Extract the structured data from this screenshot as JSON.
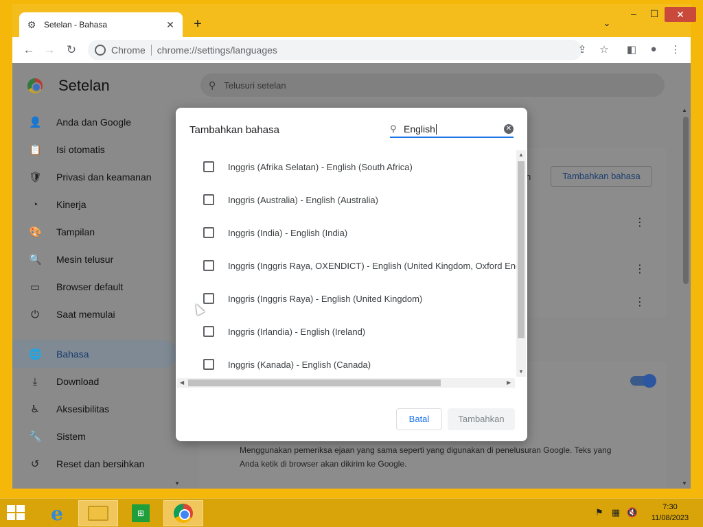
{
  "browser": {
    "tab_title": "Setelan - Bahasa",
    "new_tab": "+",
    "window_controls": {
      "minimize": "‒",
      "maximize": "☐",
      "close": "✕"
    },
    "omnibox": {
      "chip": "Chrome",
      "url": "chrome://settings/languages"
    }
  },
  "settings": {
    "title": "Setelan",
    "search_placeholder": "Telusuri setelan",
    "sidebar": [
      {
        "label": "Anda dan Google",
        "icon": "person-icon",
        "glyph": "👤"
      },
      {
        "label": "Isi otomatis",
        "icon": "clipboard-icon",
        "glyph": "📋"
      },
      {
        "label": "Privasi dan keamanan",
        "icon": "shield-icon",
        "glyph": "🛡"
      },
      {
        "label": "Kinerja",
        "icon": "gauge-icon",
        "glyph": "◔"
      },
      {
        "label": "Tampilan",
        "icon": "palette-icon",
        "glyph": "🎨"
      },
      {
        "label": "Mesin telusur",
        "icon": "search-icon",
        "glyph": "🔍"
      },
      {
        "label": "Browser default",
        "icon": "browser-icon",
        "glyph": "▭"
      },
      {
        "label": "Saat memulai",
        "icon": "power-icon",
        "glyph": "⏻"
      },
      {
        "label": "Bahasa",
        "icon": "globe-icon",
        "glyph": "🌐",
        "active": true
      },
      {
        "label": "Download",
        "icon": "download-icon",
        "glyph": "⤓"
      },
      {
        "label": "Aksesibilitas",
        "icon": "accessibility-icon",
        "glyph": "♿"
      },
      {
        "label": "Sistem",
        "icon": "wrench-icon",
        "glyph": "🔧"
      },
      {
        "label": "Reset dan bersihkan",
        "icon": "reset-icon",
        "glyph": "↺"
      }
    ],
    "card_button": "Tambahkan bahasa",
    "card_fragment": "n",
    "card2_description": "Menggunakan pemeriksa ejaan yang sama seperti yang digunakan di penelusuran Google. Teks yang Anda ketik di browser akan dikirim ke Google."
  },
  "dialog": {
    "title": "Tambahkan bahasa",
    "search_value": "English",
    "languages": [
      "Inggris (Afrika Selatan) - English (South Africa)",
      "Inggris (Australia) - English (Australia)",
      "Inggris (India) - English (India)",
      "Inggris (Inggris Raya, OXENDICT) - English (United Kingdom, Oxford English Dictionary spelling)",
      "Inggris (Inggris Raya) - English (United Kingdom)",
      "Inggris (Irlandia) - English (Ireland)",
      "Inggris (Kanada) - English (Canada)"
    ],
    "cancel_label": "Batal",
    "add_label": "Tambahkan"
  },
  "taskbar": {
    "time": "7:30",
    "date": "11/08/2023"
  },
  "colors": {
    "accent": "#1a73e8",
    "desktop": "#f5b80a",
    "dim_overlay": "#8a8a8a"
  }
}
